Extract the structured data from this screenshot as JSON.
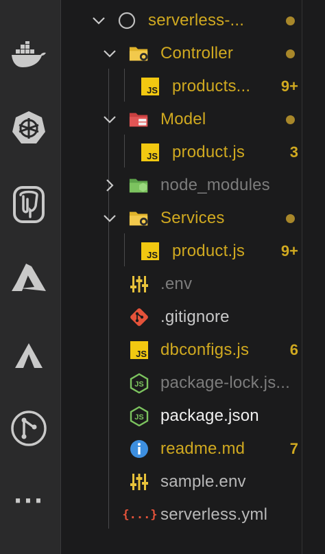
{
  "colors": {
    "modified": "#d0a920",
    "ignored": "#7c7c7c",
    "default": "#e8e8e8",
    "dot": "#a8872a",
    "activity_icon": "#c9c9c9"
  },
  "activity_bar": {
    "icons": [
      "docker-icon",
      "kubernetes-icon",
      "postgresql-icon",
      "azure-icon",
      "azure-devops-icon",
      "git-graph-icon",
      "more-icon"
    ],
    "more_label": "···"
  },
  "explorer": {
    "root": {
      "label": "serverless-...",
      "status": "dot"
    },
    "items": [
      {
        "label": "Controller",
        "type": "folder",
        "status": "dot"
      },
      {
        "label": "products...",
        "type": "js-file",
        "badge": "9+"
      },
      {
        "label": "Model",
        "type": "folder",
        "status": "dot"
      },
      {
        "label": "product.js",
        "type": "js-file",
        "badge": "3"
      },
      {
        "label": "node_modules",
        "type": "folder",
        "status": "ignored"
      },
      {
        "label": "Services",
        "type": "folder",
        "status": "dot"
      },
      {
        "label": "product.js",
        "type": "js-file",
        "badge": "9+"
      },
      {
        "label": ".env",
        "type": "env-file",
        "status": "ignored"
      },
      {
        "label": ".gitignore",
        "type": "git-file"
      },
      {
        "label": "dbconfigs.js",
        "type": "js-file",
        "badge": "6"
      },
      {
        "label": "package-lock.js...",
        "type": "json-file",
        "status": "ignored"
      },
      {
        "label": "package.json",
        "type": "json-file"
      },
      {
        "label": "readme.md",
        "type": "md-file",
        "badge": "7"
      },
      {
        "label": "sample.env",
        "type": "env-file"
      },
      {
        "label": "serverless.yml",
        "type": "yml-file"
      }
    ],
    "js_icon_label": "JS",
    "yml_icon_label": "{...}"
  }
}
